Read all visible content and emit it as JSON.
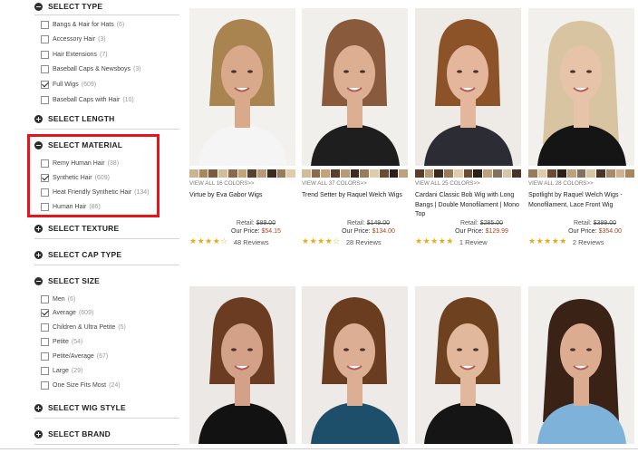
{
  "sidebar": {
    "type": {
      "title": "SELECT TYPE",
      "options": [
        {
          "label": "Bangs & Hair for Hats",
          "count": "(6)",
          "checked": false
        },
        {
          "label": "Accessory Hair",
          "count": "(3)",
          "checked": false
        },
        {
          "label": "Hair Extensions",
          "count": "(7)",
          "checked": false
        },
        {
          "label": "Baseball Caps & Newsboys",
          "count": "(3)",
          "checked": false
        },
        {
          "label": "Full Wigs",
          "count": "(609)",
          "checked": true
        },
        {
          "label": "Baseball Caps with Hair",
          "count": "(10)",
          "checked": false
        }
      ]
    },
    "length": {
      "title": "SELECT LENGTH"
    },
    "material": {
      "title": "SELECT MATERIAL",
      "options": [
        {
          "label": "Remy Human Hair",
          "count": "(38)",
          "checked": false
        },
        {
          "label": "Synthetic Hair",
          "count": "(609)",
          "checked": true
        },
        {
          "label": "Heat Friendly Synthetic Hair",
          "count": "(134)",
          "checked": false
        },
        {
          "label": "Human Hair",
          "count": "(86)",
          "checked": false
        }
      ]
    },
    "texture": {
      "title": "SELECT TEXTURE"
    },
    "cap_type": {
      "title": "SELECT CAP TYPE"
    },
    "size": {
      "title": "SELECT SIZE",
      "options": [
        {
          "label": "Men",
          "count": "(6)",
          "checked": false
        },
        {
          "label": "Average",
          "count": "(609)",
          "checked": true
        },
        {
          "label": "Children & Ultra Petite",
          "count": "(5)",
          "checked": false
        },
        {
          "label": "Petite",
          "count": "(54)",
          "checked": false
        },
        {
          "label": "Petite/Average",
          "count": "(67)",
          "checked": false
        },
        {
          "label": "Large",
          "count": "(29)",
          "checked": false
        },
        {
          "label": "One Size Fits Most",
          "count": "(24)",
          "checked": false
        }
      ]
    },
    "wig_style": {
      "title": "SELECT WIG STYLE"
    },
    "brand": {
      "title": "SELECT BRAND"
    },
    "plus_icon": "+",
    "minus_icon": "−"
  },
  "products": [
    {
      "colors_link": "VIEW ALL 16 COLORS>>",
      "name": "Virtue by Eva Gabor Wigs",
      "retail_label": "Retail:",
      "retail": "$89.00",
      "our_label": "Our Price:",
      "our": "$54.15",
      "stars": "★★★★☆",
      "reviews": "48 Reviews",
      "hair": "#a98350",
      "skin": "#d9a98c",
      "bg": "#f3f1ee",
      "top": "#f5f5f5"
    },
    {
      "colors_link": "VIEW ALL 37 COLORS>>",
      "name": "Trend Setter by Raquel Welch Wigs",
      "retail_label": "Retail:",
      "retail": "$149.00",
      "our_label": "Our Price:",
      "our": "$134.00",
      "stars": "★★★★☆",
      "reviews": "28 Reviews",
      "hair": "#8a5a3c",
      "skin": "#dcae92",
      "bg": "#f1efec",
      "top": "#1e1e1e"
    },
    {
      "colors_link": "VIEW ALL 25 COLORS>>",
      "name": "Cardani Classic Bob Wig with Long Bangs | Double Monofilament | Mono Top",
      "retail_label": "Retail:",
      "retail": "$285.00",
      "our_label": "Our Price:",
      "our": "$129.99",
      "stars": "★★★★★",
      "reviews": "1 Review",
      "hair": "#8c5228",
      "skin": "#e4b69b",
      "bg": "#eeeae6",
      "top": "#2c2c34"
    },
    {
      "colors_link": "VIEW ALL 28 COLORS>>",
      "name": "Spotlight by Raquel Welch Wigs - Monofilament, Lace Front Wig",
      "retail_label": "Retail:",
      "retail": "$399.00",
      "our_label": "Our Price:",
      "our": "$354.00",
      "stars": "★★★★★",
      "reviews": "2 Reviews",
      "hair": "#d8c4a0",
      "skin": "#e6c3a9",
      "bg": "#f2f0ed",
      "top": "#151515"
    },
    {
      "hair": "#6b3c22",
      "skin": "#d2a187",
      "bg": "#ebe8e5",
      "top": "#121212"
    },
    {
      "hair": "#6a3c20",
      "skin": "#dcae93",
      "bg": "#eeeae7",
      "top": "#1d4f6a"
    },
    {
      "hair": "#6e4220",
      "skin": "#e2b89c",
      "bg": "#eeebe8",
      "top": "#151515"
    },
    {
      "hair": "#3a2216",
      "skin": "#dcac90",
      "bg": "#f0eeeb",
      "top": "#7fb2d9"
    }
  ],
  "swatch_colors": [
    "#cfb28f",
    "#a78660",
    "#7a5b3f",
    "#d4bc98",
    "#8a6a4a",
    "#c5a27a",
    "#5b3f2a",
    "#b89a76",
    "#3d2a1e",
    "#9a7a58",
    "#e0cca8",
    "#6b4b33",
    "#2c1f18",
    "#bfa07c",
    "#857060",
    "#d9c4a3",
    "#4b3426",
    "#aa8b69"
  ],
  "colors": {
    "accent_red": "#e8141c",
    "price_red": "#b33f1a",
    "star": "#e6ad14"
  }
}
